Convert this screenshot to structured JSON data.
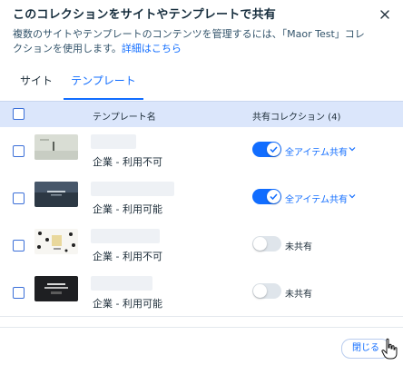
{
  "dialog": {
    "title": "このコレクションをサイトやテンプレートで共有",
    "description": "複数のサイトやテンプレートのコンテンツを管理するには、「Maor Test」コレクションを使用します。",
    "details_link": "詳細はこちら"
  },
  "tabs": [
    {
      "label": "サイト",
      "active": false
    },
    {
      "label": "テンプレート",
      "active": true
    }
  ],
  "table": {
    "headers": {
      "name": "テンプレート名",
      "shared_collections": "共有コレクション (4)"
    },
    "rows": [
      {
        "status": "企業 - 利用不可",
        "shared": true,
        "share_label": "全アイテム共有"
      },
      {
        "status": "企業 - 利用可能",
        "shared": true,
        "share_label": "全アイテム共有"
      },
      {
        "status": "企業 - 利用不可",
        "shared": false,
        "share_label": "未共有"
      },
      {
        "status": "企業 - 利用可能",
        "shared": false,
        "share_label": "未共有"
      }
    ]
  },
  "footer": {
    "close_label": "閉じる"
  },
  "colors": {
    "accent": "#116dff",
    "header_bg": "#dbe6fb",
    "toggle_off": "#dfe5eb"
  }
}
